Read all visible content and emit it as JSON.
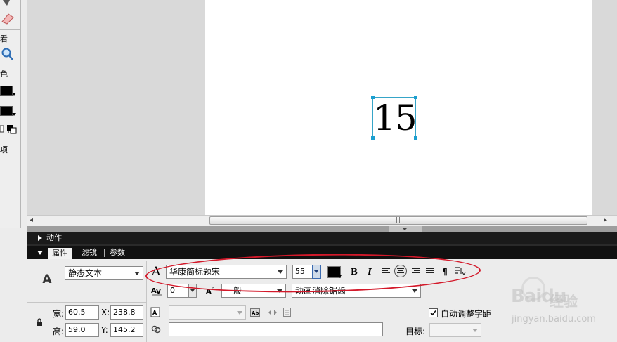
{
  "toolbox": {
    "view_label": "看",
    "color_label": "色",
    "options_label": "项",
    "stroke_color": "#000000",
    "fill_color": "#000000"
  },
  "stage": {
    "text_content": "15",
    "selection_color": "#36a5c8"
  },
  "panels": {
    "actions_title": "动作",
    "tabs": [
      {
        "label": "属性",
        "active": true
      },
      {
        "label": "滤镜",
        "active": false
      },
      {
        "label": "参数",
        "active": false
      }
    ]
  },
  "properties": {
    "text_tool_glyph": "A",
    "text_type": "静态文本",
    "font_glyph": "A",
    "font_family": "华康简标题宋",
    "font_size": "55",
    "text_color": "#000000",
    "bold_glyph": "B",
    "italic_glyph": "I",
    "paragraph_glyph": "¶",
    "letter_spacing": "0",
    "char_position": "一般",
    "antialias": "动画消除锯齿",
    "width_label": "宽:",
    "width_value": "60.5",
    "height_label": "高:",
    "height_value": "59.0",
    "x_label": "X:",
    "x_value": "238.8",
    "y_label": "Y:",
    "y_value": "145.2",
    "auto_kern_label": "自动调整字距",
    "auto_kern_checked": true,
    "target_label": "目标:",
    "url_value": ""
  },
  "annotation": {
    "highlight_color": "#d3192a"
  },
  "watermark": {
    "brand": "Baidu",
    "brand_suffix": "经验",
    "url": "jingyan.baidu.com"
  }
}
